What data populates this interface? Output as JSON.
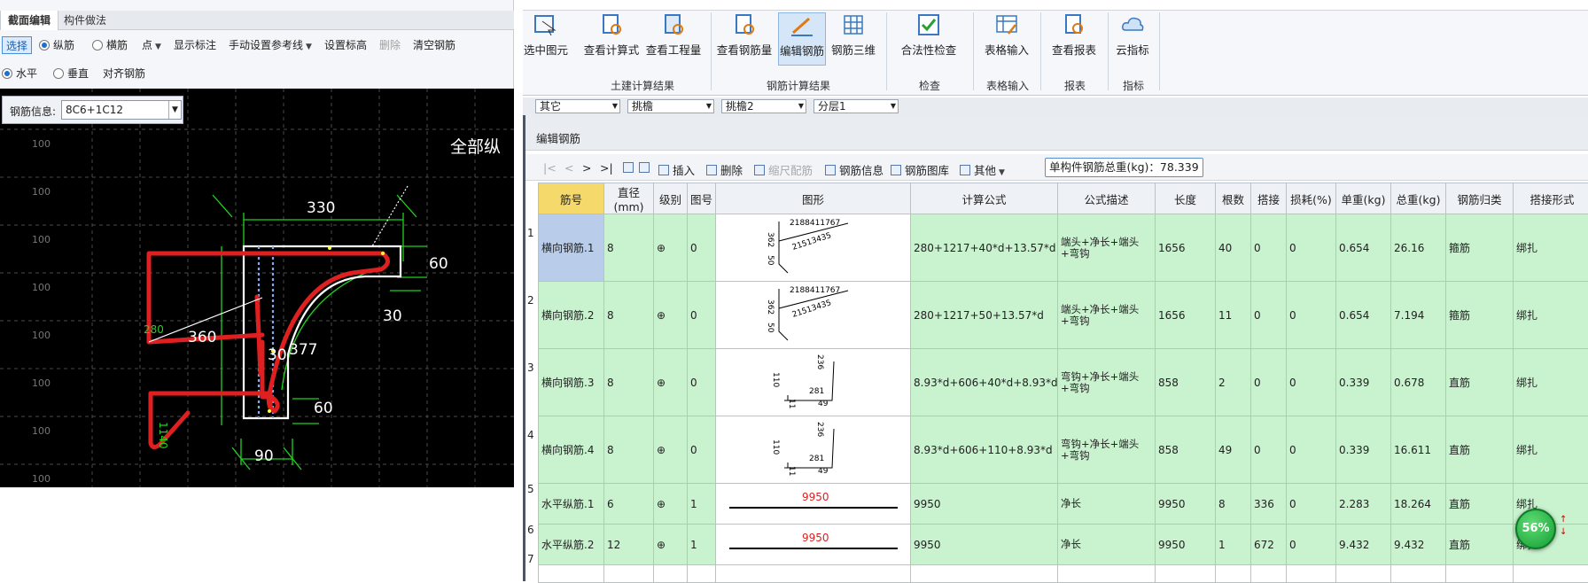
{
  "left_panel": {
    "tabs": [
      "截面编辑",
      "构件做法"
    ],
    "toolbar1": {
      "select": "选择",
      "radio_longitudinal": "纵筋",
      "radio_transverse": "横筋",
      "point": "点",
      "show_annotation": "显示标注",
      "manual_ref_line": "手动设置参考线",
      "set_elevation": "设置标高",
      "delete": "删除",
      "clear_rebar": "清空钢筋"
    },
    "toolbar2": {
      "horizontal": "水平",
      "vertical": "垂直",
      "align_rebar": "对齐钢筋"
    },
    "rebar_info_label": "钢筋信息:",
    "rebar_info_value": "8C6+1C12",
    "grid_labels": [
      "100",
      "100",
      "100",
      "100",
      "100",
      "100",
      "100",
      "100"
    ],
    "drawing_labels": {
      "dim_top": "330",
      "dim_right_top": "60",
      "dim_right_mid": "30",
      "dim_left": "360",
      "dim_inner_30": "30",
      "dim_inner_377": "377",
      "dim_right_bottom": "60",
      "dim_bottom": "90",
      "green_280": "280",
      "green_left": "1140",
      "callout": "全部纵"
    }
  },
  "ribbon": {
    "buttons": [
      "选中图元",
      "查看计算式",
      "查看工程量",
      "查看钢筋量",
      "编辑钢筋",
      "钢筋三维",
      "合法性检查",
      "表格输入",
      "查看报表",
      "云指标"
    ],
    "groups": [
      "土建计算结果",
      "钢筋计算结果",
      "检查",
      "表格输入",
      "报表",
      "指标"
    ],
    "dropdowns": [
      "其它",
      "挑檐",
      "挑檐2",
      "分层1"
    ]
  },
  "panel": {
    "title": "编辑钢筋",
    "toolbar": {
      "insert": "插入",
      "delete": "删除",
      "scale_rebar": "缩尺配筋",
      "rebar_info": "钢筋信息",
      "rebar_library": "钢筋图库",
      "other": "其他",
      "total_weight": "单构件钢筋总重(kg)：78.339"
    },
    "columns": [
      "筋号",
      "直径(mm)",
      "级别",
      "图号",
      "图形",
      "计算公式",
      "公式描述",
      "长度",
      "根数",
      "搭接",
      "损耗(%)",
      "单重(kg)",
      "总重(kg)",
      "钢筋归类",
      "搭接形式"
    ],
    "rows": [
      {
        "num": "1",
        "name": "横向钢筋.1",
        "dia": "8",
        "grade": "⊕",
        "fig": "0",
        "formula": "280+1217+40*d+13.57*d",
        "desc": "端头+净长+端头+弯钩",
        "length": "1656",
        "count": "40",
        "lap": "0",
        "loss": "0",
        "unit_w": "0.654",
        "total_w": "26.16",
        "category": "箍筋",
        "lap_type": "绑扎",
        "shape_labels": [
          "362",
          "2188411767",
          "50",
          "21513435"
        ]
      },
      {
        "num": "2",
        "name": "横向钢筋.2",
        "dia": "8",
        "grade": "⊕",
        "fig": "0",
        "formula": "280+1217+50+13.57*d",
        "desc": "端头+净长+端头+弯钩",
        "length": "1656",
        "count": "11",
        "lap": "0",
        "loss": "0",
        "unit_w": "0.654",
        "total_w": "7.194",
        "category": "箍筋",
        "lap_type": "绑扎",
        "shape_labels": [
          "362",
          "2188411767",
          "50",
          "21513435"
        ]
      },
      {
        "num": "3",
        "name": "横向钢筋.3",
        "dia": "8",
        "grade": "⊕",
        "fig": "0",
        "formula": "8.93*d+606+40*d+8.93*d",
        "desc": "弯钩+净长+端头+弯钩",
        "length": "858",
        "count": "2",
        "lap": "0",
        "loss": "0",
        "unit_w": "0.339",
        "total_w": "0.678",
        "category": "直筋",
        "lap_type": "绑扎",
        "shape_labels": [
          "110",
          "236",
          "281",
          "49",
          "11"
        ]
      },
      {
        "num": "4",
        "name": "横向钢筋.4",
        "dia": "8",
        "grade": "⊕",
        "fig": "0",
        "formula": "8.93*d+606+110+8.93*d",
        "desc": "弯钩+净长+端头+弯钩",
        "length": "858",
        "count": "49",
        "lap": "0",
        "loss": "0",
        "unit_w": "0.339",
        "total_w": "16.611",
        "category": "直筋",
        "lap_type": "绑扎",
        "shape_labels": [
          "110",
          "236",
          "281",
          "49",
          "11"
        ]
      },
      {
        "num": "5",
        "name": "水平纵筋.1",
        "dia": "6",
        "grade": "⊕",
        "fig": "1",
        "formula": "9950",
        "desc": "净长",
        "length": "9950",
        "count": "8",
        "lap": "336",
        "loss": "0",
        "unit_w": "2.283",
        "total_w": "18.264",
        "category": "直筋",
        "lap_type": "绑扎",
        "shape_labels": [
          "9950"
        ]
      },
      {
        "num": "6",
        "name": "水平纵筋.2",
        "dia": "12",
        "grade": "⊕",
        "fig": "1",
        "formula": "9950",
        "desc": "净长",
        "length": "9950",
        "count": "1",
        "lap": "672",
        "loss": "0",
        "unit_w": "9.432",
        "total_w": "9.432",
        "category": "直筋",
        "lap_type": "绑扎",
        "shape_labels": [
          "9950"
        ]
      }
    ],
    "empty_row_num": "7"
  },
  "badge": "56%",
  "colors": {
    "row_green": "#c9f2cf",
    "accent_blue": "#1b6fd0",
    "annotation_red": "#e02020"
  }
}
